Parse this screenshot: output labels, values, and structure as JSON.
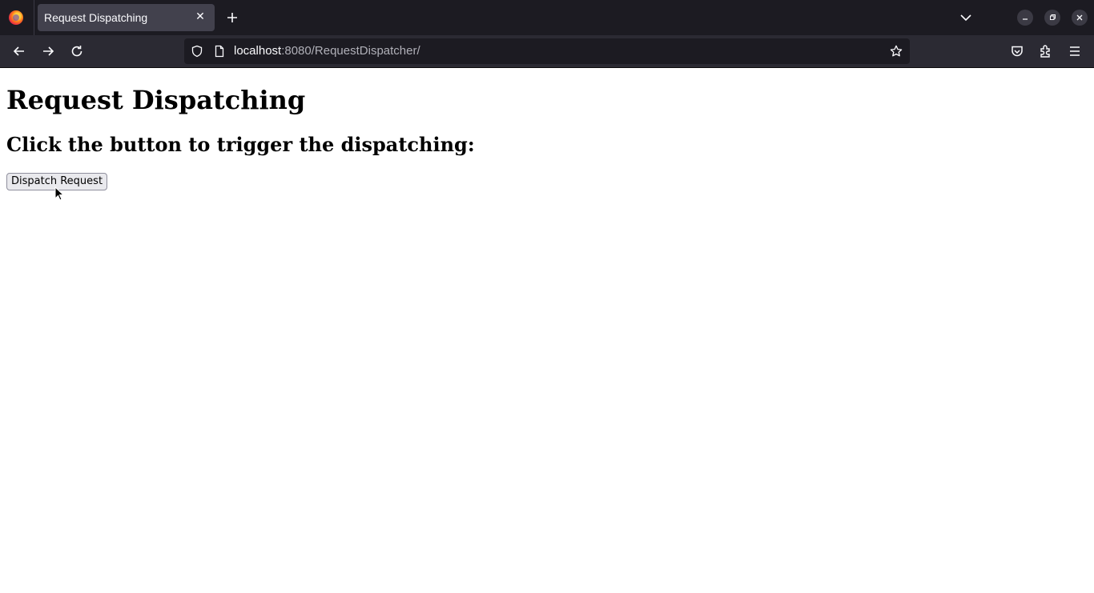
{
  "browser": {
    "tab": {
      "title": "Request Dispatching",
      "close_glyph": "✕"
    },
    "url": {
      "host": "localhost",
      "rest": ":8080/RequestDispatcher/"
    },
    "icons": {
      "logo": "firefox-logo-icon",
      "new_tab": "plus-icon",
      "tab_list": "chevron-down-icon",
      "back": "arrow-left-icon",
      "forward": "arrow-right-icon",
      "reload": "reload-icon",
      "tracking": "shield-icon",
      "page_info": "document-icon",
      "bookmark": "star-icon",
      "pocket": "pocket-icon",
      "extensions": "puzzle-icon",
      "menu": "hamburger-icon"
    }
  },
  "page": {
    "heading": "Request Dispatching",
    "subheading": "Click the button to trigger the dispatching:",
    "button_label": "Dispatch Request"
  },
  "colors": {
    "chrome_dark": "#1c1b22",
    "toolbar": "#2b2a33",
    "active_tab": "#42414d",
    "button_bg": "#e9e9ed"
  }
}
